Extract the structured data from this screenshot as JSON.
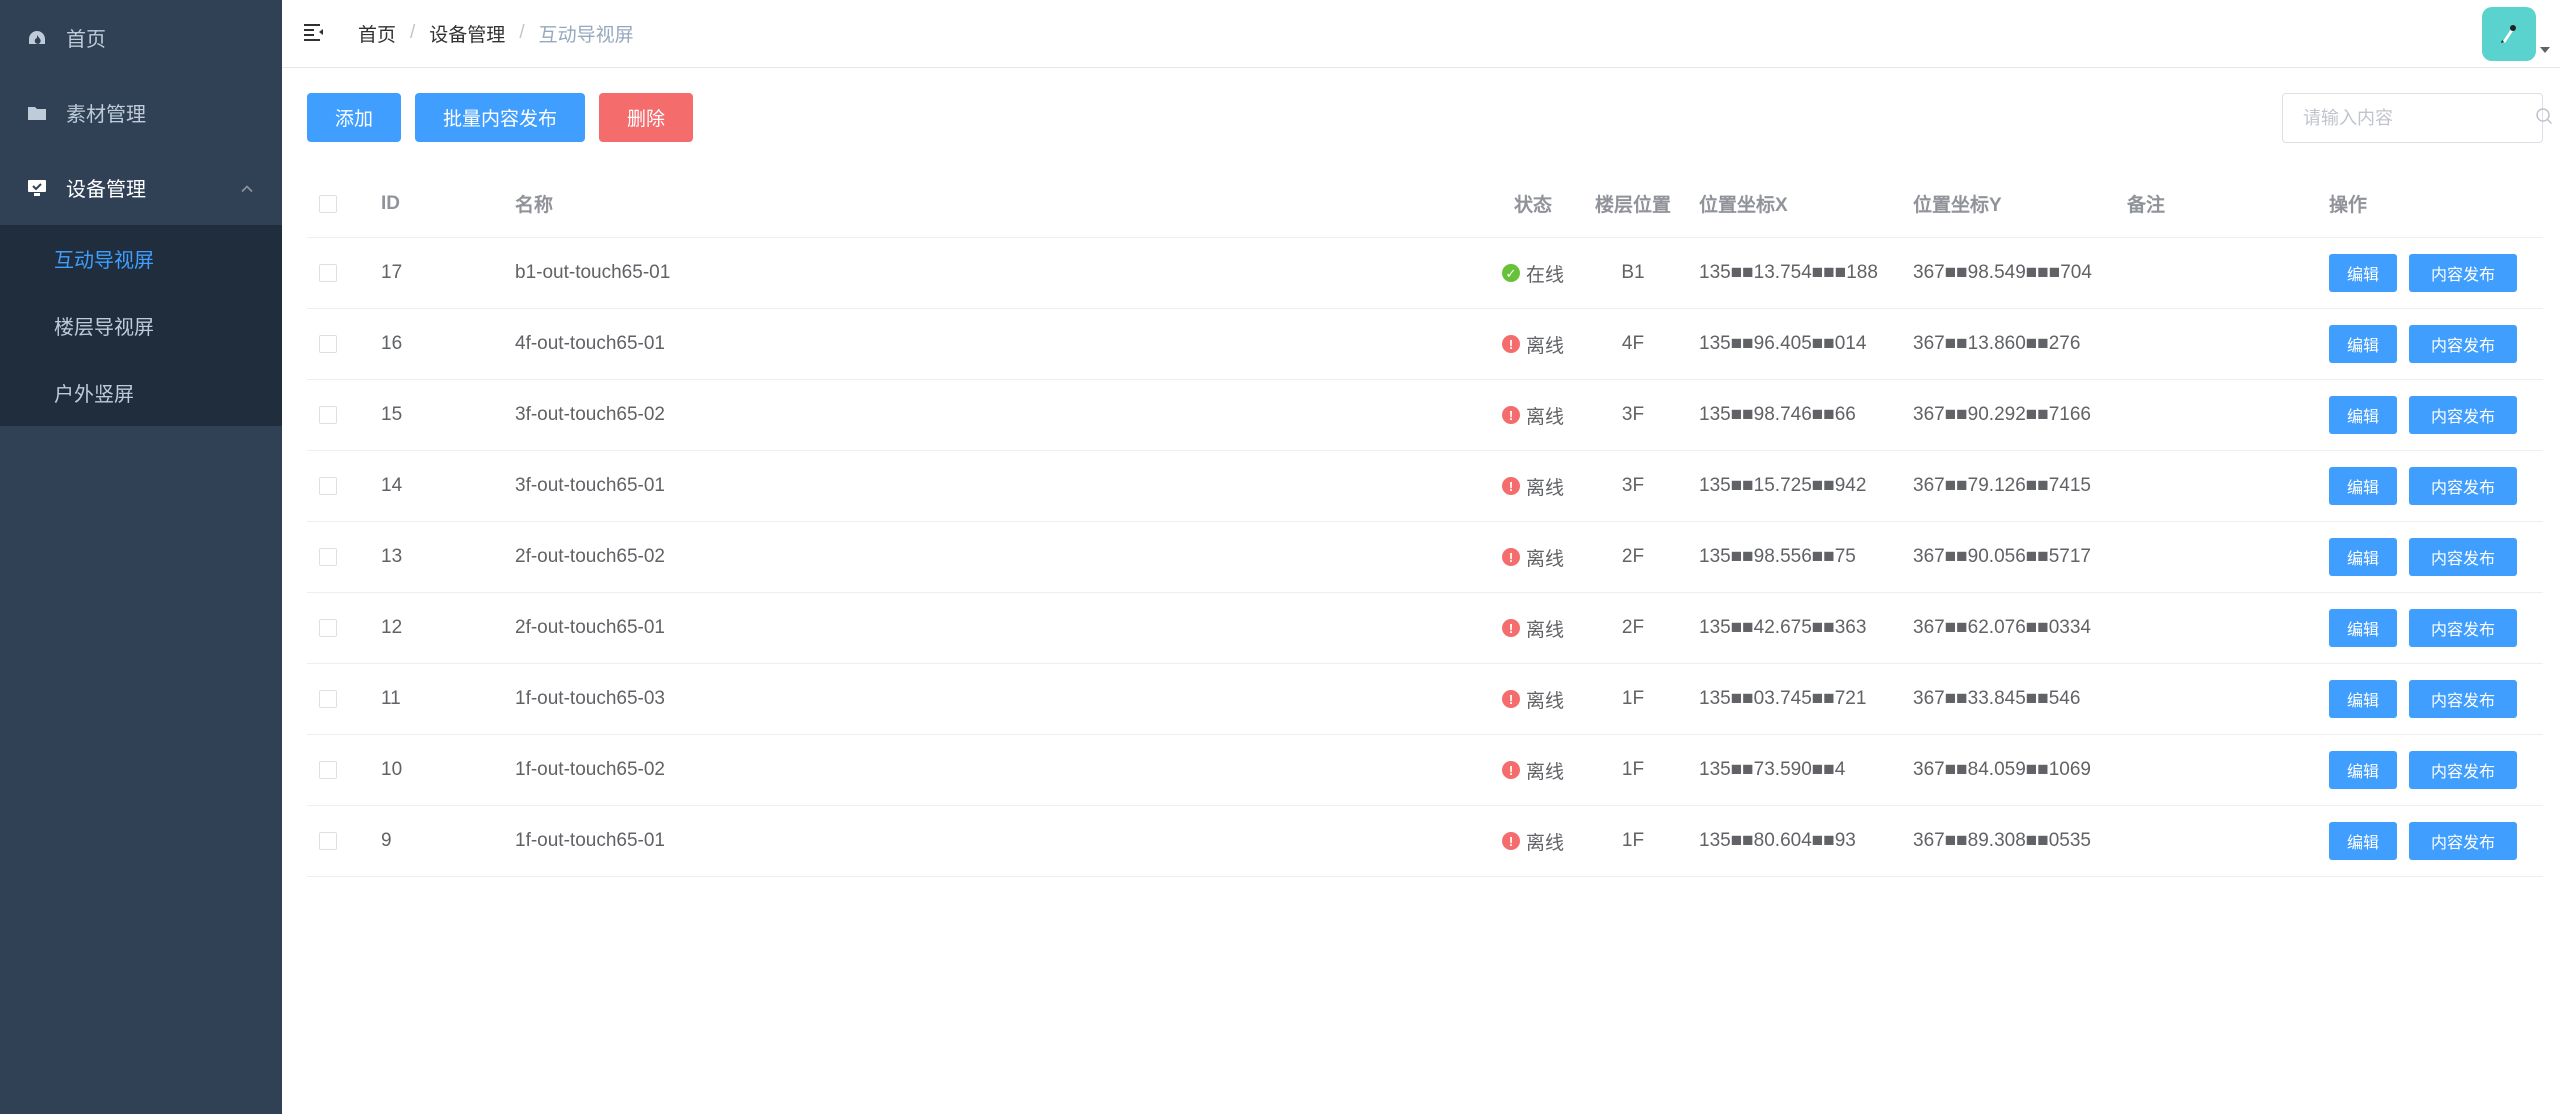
{
  "sidebar": {
    "items": [
      {
        "label": "首页",
        "icon": "dashboard-icon"
      },
      {
        "label": "素材管理",
        "icon": "folder-icon"
      },
      {
        "label": "设备管理",
        "icon": "monitor-icon",
        "expanded": true
      }
    ],
    "submenu": [
      {
        "label": "互动导视屏",
        "active": true
      },
      {
        "label": "楼层导视屏",
        "active": false
      },
      {
        "label": "户外竖屏",
        "active": false
      }
    ]
  },
  "header": {
    "breadcrumb": [
      "首页",
      "设备管理",
      "互动导视屏"
    ],
    "separator": "/"
  },
  "toolbar": {
    "add_label": "添加",
    "batch_publish_label": "批量内容发布",
    "delete_label": "删除"
  },
  "search": {
    "placeholder": "请输入内容"
  },
  "table": {
    "headers": {
      "id": "ID",
      "name": "名称",
      "status": "状态",
      "floor": "楼层位置",
      "x": "位置坐标X",
      "y": "位置坐标Y",
      "note": "备注",
      "ops": "操作"
    },
    "edit_label": "编辑",
    "publish_label": "内容发布",
    "rows": [
      {
        "id": "17",
        "name": "b1-out-touch65-01",
        "status": "在线",
        "online": true,
        "floor": "B1",
        "x": "135■■13.754■■■188",
        "y": "367■■98.549■■■704",
        "note": ""
      },
      {
        "id": "16",
        "name": "4f-out-touch65-01",
        "status": "离线",
        "online": false,
        "floor": "4F",
        "x": "135■■96.405■■014",
        "y": "367■■13.860■■276",
        "note": ""
      },
      {
        "id": "15",
        "name": "3f-out-touch65-02",
        "status": "离线",
        "online": false,
        "floor": "3F",
        "x": "135■■98.746■■66",
        "y": "367■■90.292■■7166",
        "note": ""
      },
      {
        "id": "14",
        "name": "3f-out-touch65-01",
        "status": "离线",
        "online": false,
        "floor": "3F",
        "x": "135■■15.725■■942",
        "y": "367■■79.126■■7415",
        "note": ""
      },
      {
        "id": "13",
        "name": "2f-out-touch65-02",
        "status": "离线",
        "online": false,
        "floor": "2F",
        "x": "135■■98.556■■75",
        "y": "367■■90.056■■5717",
        "note": ""
      },
      {
        "id": "12",
        "name": "2f-out-touch65-01",
        "status": "离线",
        "online": false,
        "floor": "2F",
        "x": "135■■42.675■■363",
        "y": "367■■62.076■■0334",
        "note": ""
      },
      {
        "id": "11",
        "name": "1f-out-touch65-03",
        "status": "离线",
        "online": false,
        "floor": "1F",
        "x": "135■■03.745■■721",
        "y": "367■■33.845■■546",
        "note": ""
      },
      {
        "id": "10",
        "name": "1f-out-touch65-02",
        "status": "离线",
        "online": false,
        "floor": "1F",
        "x": "135■■73.590■■4",
        "y": "367■■84.059■■1069",
        "note": ""
      },
      {
        "id": "9",
        "name": "1f-out-touch65-01",
        "status": "离线",
        "online": false,
        "floor": "1F",
        "x": "135■■80.604■■93",
        "y": "367■■89.308■■0535",
        "note": ""
      }
    ]
  },
  "colors": {
    "sidebar_bg": "#304156",
    "submenu_bg": "#1f2d3d",
    "primary": "#409eff",
    "danger": "#f56c6c",
    "success": "#67c23a"
  }
}
